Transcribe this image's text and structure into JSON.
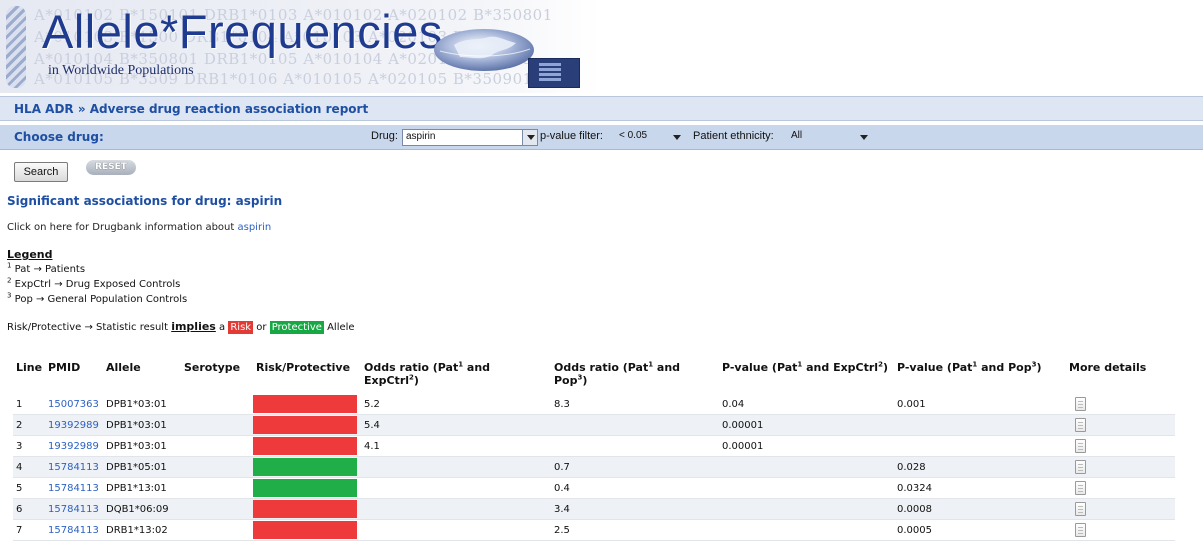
{
  "banner": {
    "title": "Allele*Frequencies",
    "subtitle": "in Worldwide Populations",
    "bg_text_1": "A*010102   B*150101   DRB1*0103   A*010102   A*020102 B*350801",
    "bg_text_2": "A*010103   B*1500   DRB1*0104   A*010103   A*020103 B*3509",
    "bg_text_3": "A*010104   B*350801   DRB1*0105   A*010104   A*020104 B*3509",
    "bg_text_4": "A*010105   B*3509   DRB1*0106   A*010105   A*020105 B*350901"
  },
  "breadcrumb": "HLA ADR » Adverse drug reaction association report",
  "filter": {
    "choose_label": "Choose drug:",
    "drug_label": "Drug:",
    "drug_value": "aspirin",
    "pvalue_label": "p-value filter:",
    "pvalue_value": "< 0.05",
    "ethnicity_label": "Patient ethnicity:",
    "ethnicity_value": "All"
  },
  "buttons": {
    "search": "Search",
    "reset": "RESET"
  },
  "results_title": "Significant associations for drug: aspirin",
  "drugbank": {
    "text": "Click on here for Drugbank information about ",
    "link": "aspirin"
  },
  "legend": {
    "title": "Legend",
    "items": [
      {
        "num": "1",
        "text": "Pat → Patients"
      },
      {
        "num": "2",
        "text": "ExpCtrl → Drug Exposed Controls"
      },
      {
        "num": "3",
        "text": "Pop → General Population Controls"
      }
    ],
    "implies_prefix": "Risk/Protective → Statistic result ",
    "implies_word": "implies",
    "implies_a": " a ",
    "risk": "Risk",
    "or": " or ",
    "protective": "Protective",
    "allele": " Allele"
  },
  "table": {
    "headers": {
      "line": "Line",
      "pmid": "PMID",
      "allele": "Allele",
      "serotype": "Serotype",
      "risk": "Risk/Protective",
      "or_exp": "Odds ratio (Pat",
      "or_exp_sup1": "1",
      "or_exp_mid": " and ExpCtrl",
      "or_exp_sup2": "2",
      "or_exp_end": ")",
      "or_pop": "Odds ratio (Pat",
      "or_pop_sup1": "1",
      "or_pop_mid": " and Pop",
      "or_pop_sup2": "3",
      "or_pop_end": ")",
      "p_exp": "P-value (Pat",
      "p_exp_sup1": "1",
      "p_exp_mid": " and ExpCtrl",
      "p_exp_sup2": "2",
      "p_exp_end": ")",
      "p_pop": "P-value (Pat",
      "p_pop_sup1": "1",
      "p_pop_mid": " and Pop",
      "p_pop_sup2": "3",
      "p_pop_end": ")",
      "details": "More details"
    },
    "rows": [
      {
        "line": "1",
        "pmid": "15007363",
        "allele": "DPB1*03:01",
        "serotype": "",
        "type": "risk",
        "or_exp": "5.2",
        "or_pop": "8.3",
        "p_exp": "0.04",
        "p_pop": "0.001"
      },
      {
        "line": "2",
        "pmid": "19392989",
        "allele": "DPB1*03:01",
        "serotype": "",
        "type": "risk",
        "or_exp": "5.4",
        "or_pop": "",
        "p_exp": "0.00001",
        "p_pop": ""
      },
      {
        "line": "3",
        "pmid": "19392989",
        "allele": "DPB1*03:01",
        "serotype": "",
        "type": "risk",
        "or_exp": "4.1",
        "or_pop": "",
        "p_exp": "0.00001",
        "p_pop": ""
      },
      {
        "line": "4",
        "pmid": "15784113",
        "allele": "DPB1*05:01",
        "serotype": "",
        "type": "protective",
        "or_exp": "",
        "or_pop": "0.7",
        "p_exp": "",
        "p_pop": "0.028"
      },
      {
        "line": "5",
        "pmid": "15784113",
        "allele": "DPB1*13:01",
        "serotype": "",
        "type": "protective",
        "or_exp": "",
        "or_pop": "0.4",
        "p_exp": "",
        "p_pop": "0.0324"
      },
      {
        "line": "6",
        "pmid": "15784113",
        "allele": "DQB1*06:09",
        "serotype": "",
        "type": "risk",
        "or_exp": "",
        "or_pop": "3.4",
        "p_exp": "",
        "p_pop": "0.0008"
      },
      {
        "line": "7",
        "pmid": "15784113",
        "allele": "DRB1*13:02",
        "serotype": "",
        "type": "risk",
        "or_exp": "",
        "or_pop": "2.5",
        "p_exp": "",
        "p_pop": "0.0005"
      }
    ]
  },
  "colors": {
    "risk": "#ee3a3a",
    "protective": "#1fae47",
    "link": "#2d62c2",
    "heading": "#1e4fa3"
  },
  "icons": {
    "details": "document-icon",
    "dropdown": "chevron-down-icon",
    "helix": "dna-helix-icon",
    "globe": "globe-icon"
  }
}
